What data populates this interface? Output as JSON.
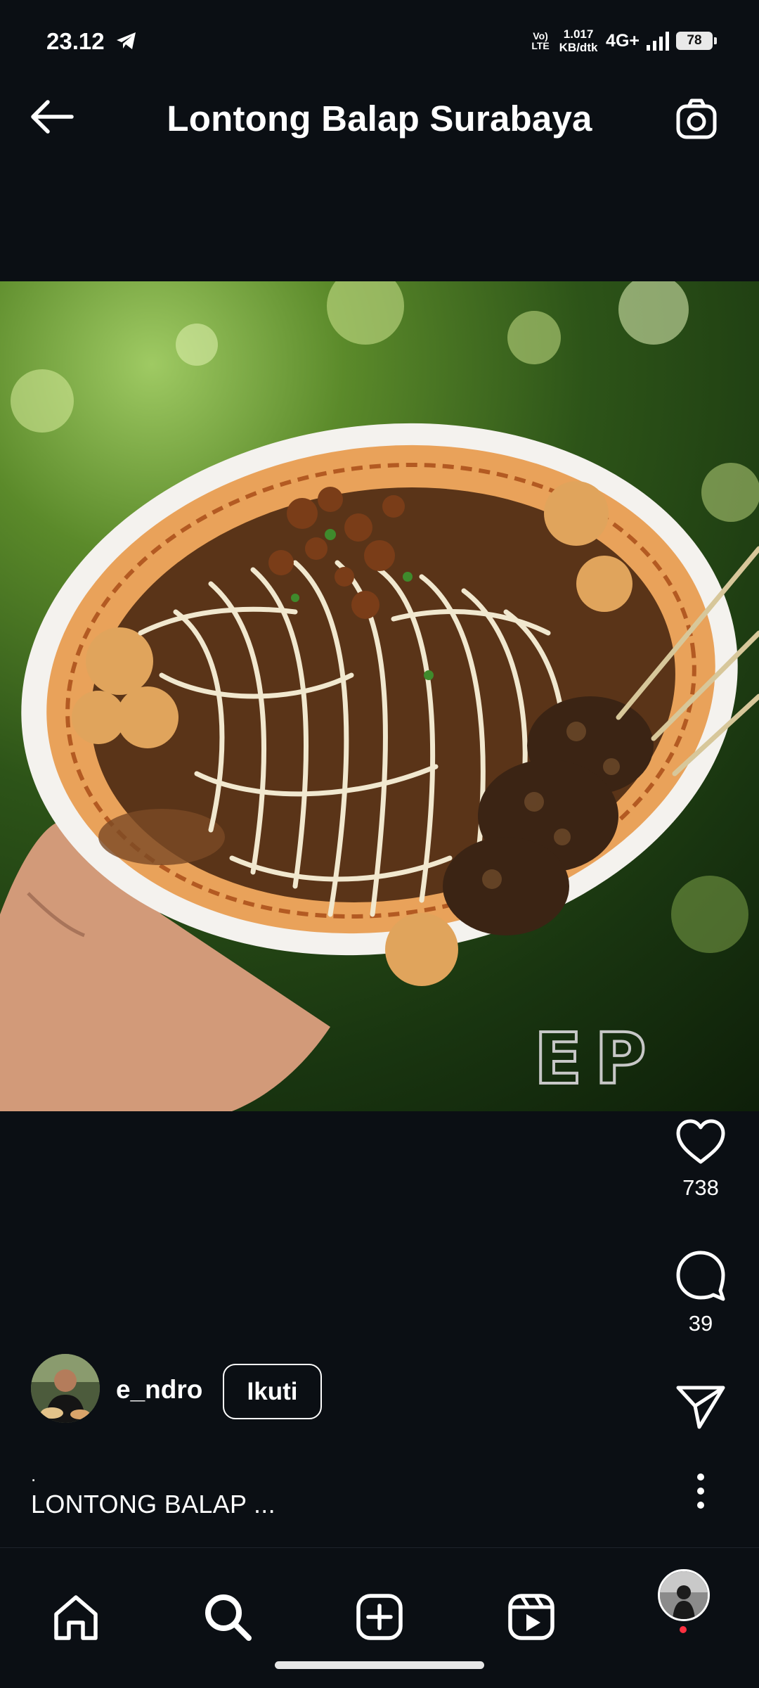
{
  "status_bar": {
    "time": "23.12",
    "volte_label": "Vo) LTE",
    "net_speed_value": "1.017",
    "net_speed_unit": "KB/dtk",
    "network": "4G+",
    "battery": "78",
    "icons": [
      "telegram-icon",
      "signal-icon",
      "battery-icon"
    ]
  },
  "header": {
    "title": "Lontong Balap Surabaya",
    "back_icon": "arrow-left-icon",
    "camera_icon": "camera-icon"
  },
  "post": {
    "photo_subject": "lontong-balap-dish",
    "watermark": "EP",
    "likes": "738",
    "comments": "39",
    "author": {
      "username": "e_ndro",
      "follow_label": "Ikuti"
    },
    "caption_prefix": ".",
    "caption": "LONTONG BALAP ..."
  },
  "bottom_nav": {
    "items": [
      "home-icon",
      "search-icon",
      "create-icon",
      "reels-icon",
      "profile-avatar"
    ]
  },
  "colors": {
    "background": "#0b0f14",
    "text": "#ffffff",
    "notification_dot": "#ff3040"
  }
}
